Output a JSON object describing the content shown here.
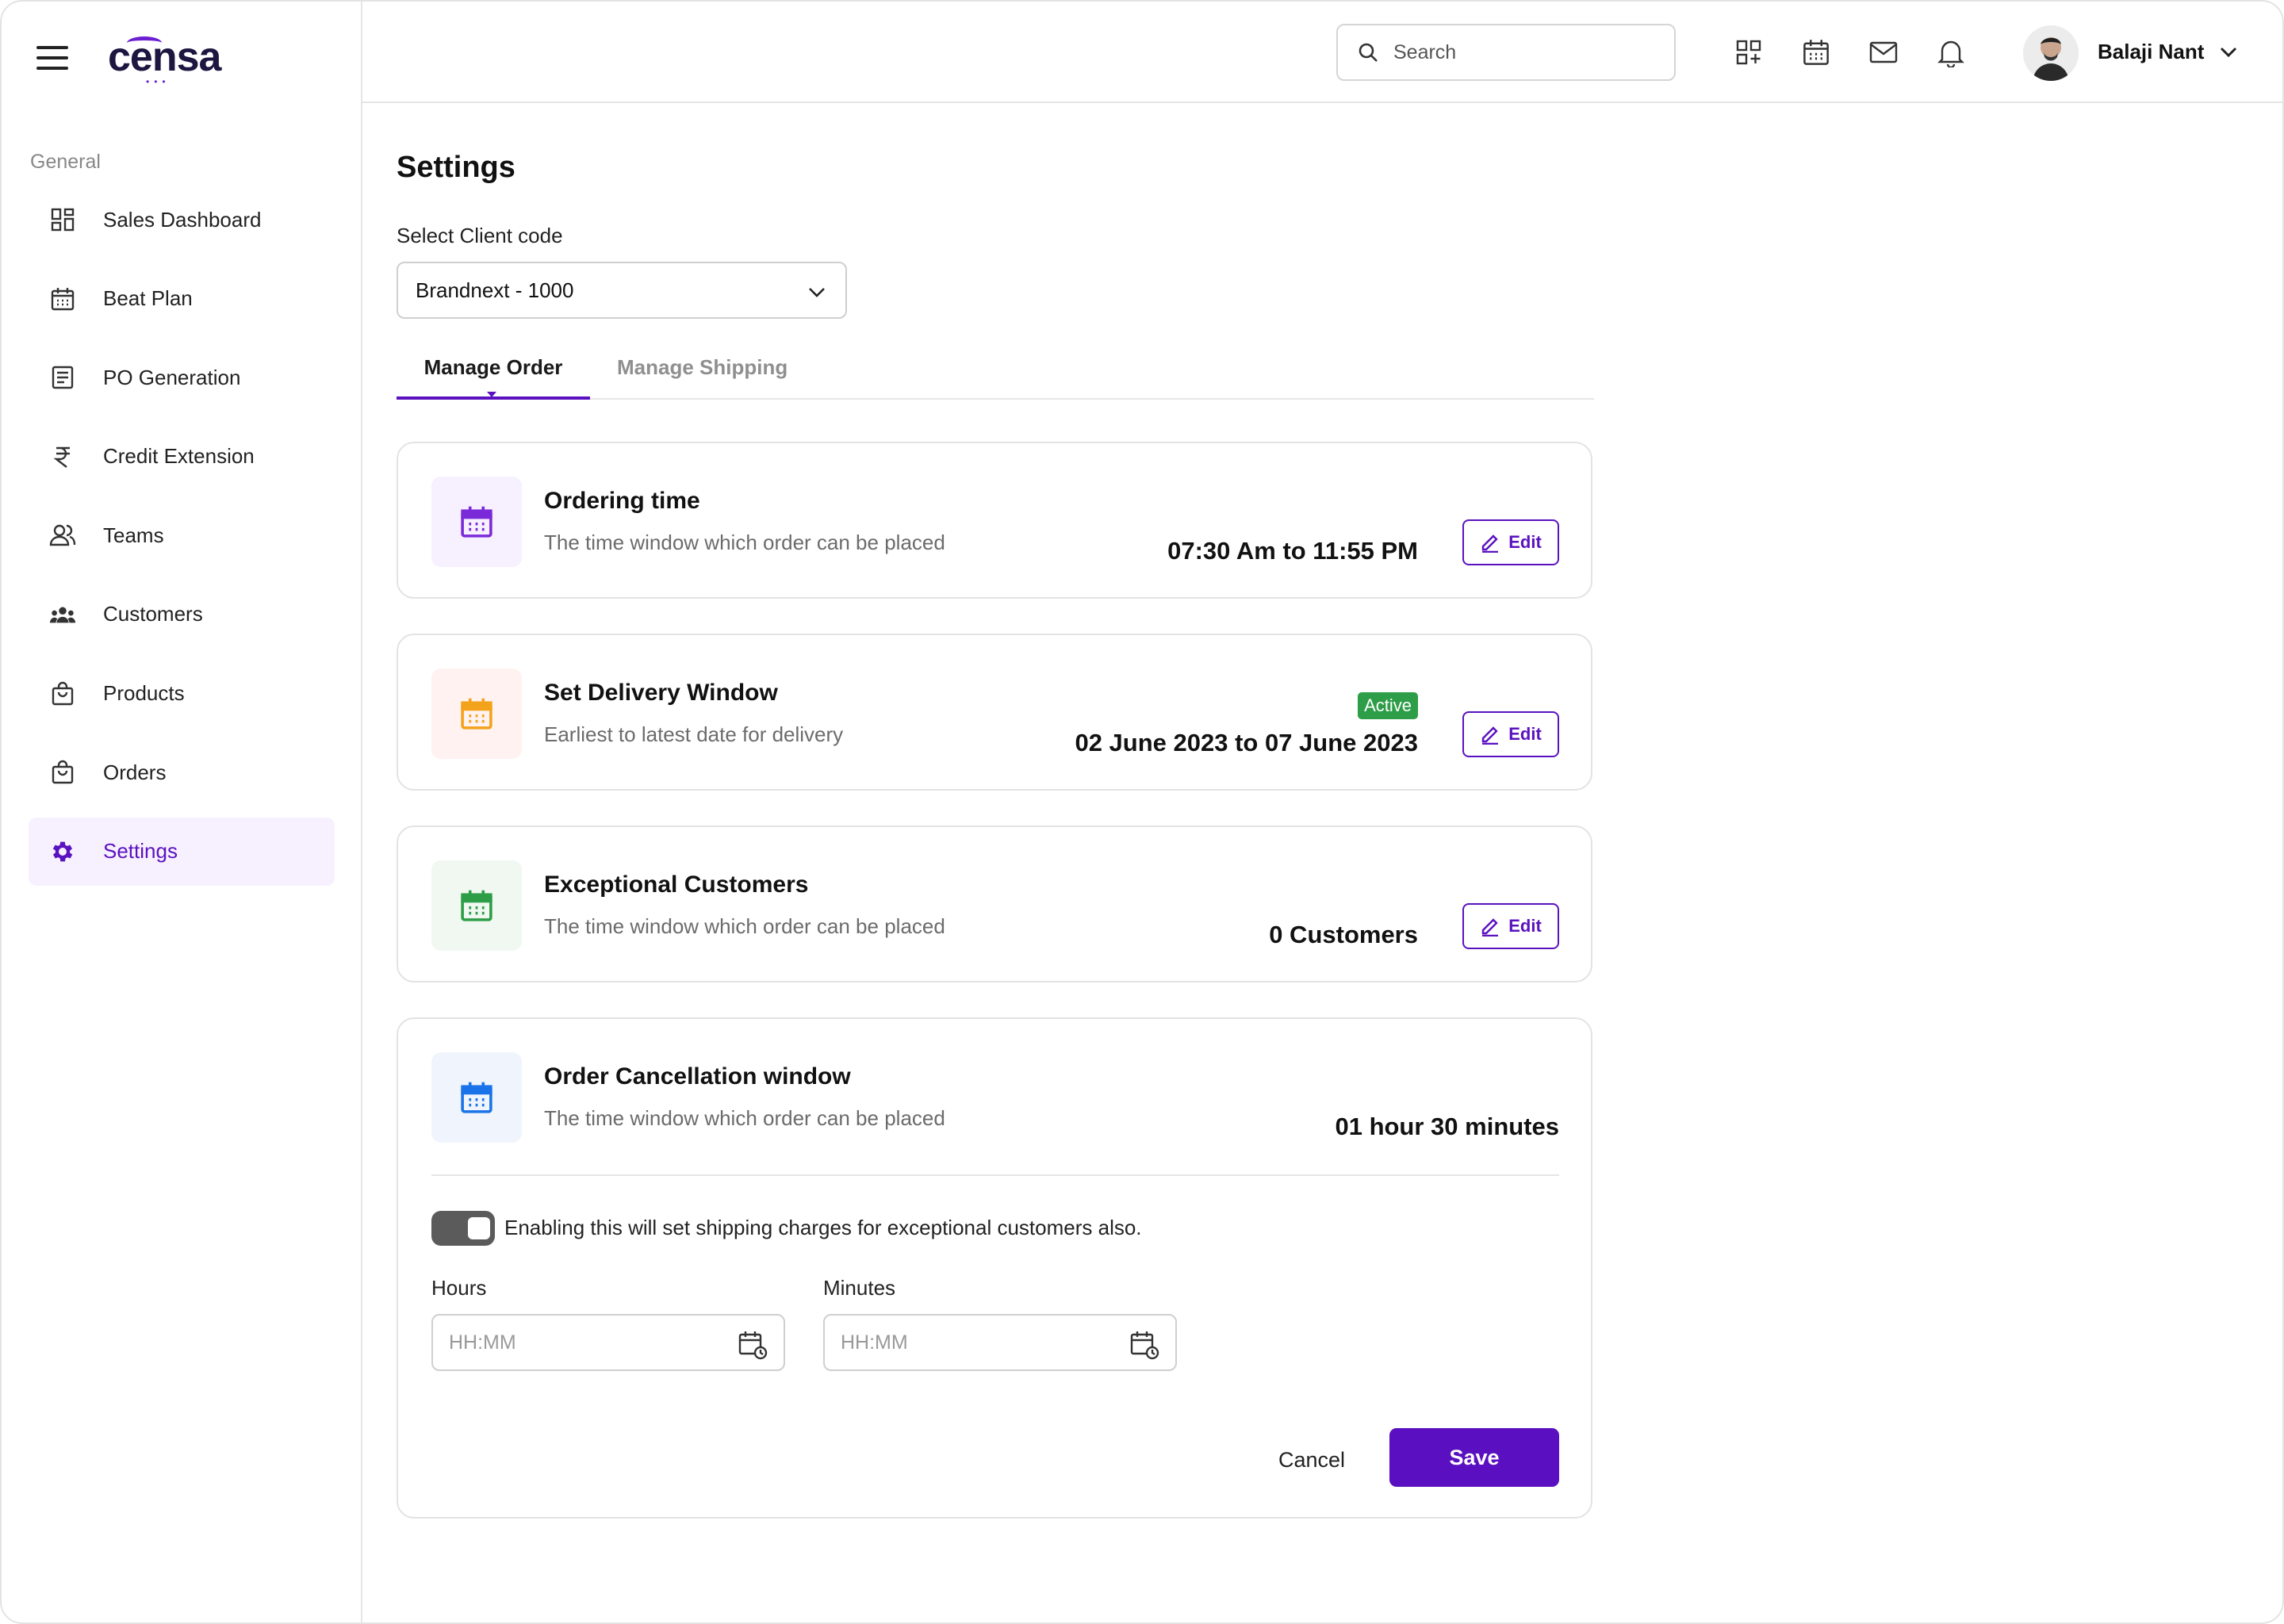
{
  "app": {
    "logo_text": "censa"
  },
  "sidebar": {
    "section_label": "General",
    "items": [
      {
        "label": "Sales Dashboard",
        "icon": "dashboard-grid-icon"
      },
      {
        "label": "Beat Plan",
        "icon": "calendar-icon"
      },
      {
        "label": "PO Generation",
        "icon": "document-icon"
      },
      {
        "label": "Credit Extension",
        "icon": "rupee-icon"
      },
      {
        "label": "Teams",
        "icon": "users-icon"
      },
      {
        "label": "Customers",
        "icon": "customers-group-icon"
      },
      {
        "label": "Products",
        "icon": "shopping-bag-icon"
      },
      {
        "label": "Orders",
        "icon": "shopping-bag-icon"
      },
      {
        "label": "Settings",
        "icon": "gear-icon",
        "active": true
      }
    ]
  },
  "topbar": {
    "search_placeholder": "Search",
    "user_name": "Balaji Nant"
  },
  "page": {
    "title": "Settings",
    "client_label": "Select Client code",
    "client_value": "Brandnext - 1000",
    "tabs": [
      {
        "label": "Manage Order",
        "active": true
      },
      {
        "label": "Manage Shipping",
        "active": false
      }
    ]
  },
  "cards": [
    {
      "title": "Ordering time",
      "subtitle": "The time window which order can be placed",
      "value": "07:30 Am to 11:55 PM",
      "edit_label": "Edit",
      "icon_color": "#7b2ad9",
      "icon_bg": "#f6f0ff"
    },
    {
      "title": "Set Delivery Window",
      "subtitle": "Earliest to latest date for delivery",
      "value": "02 June 2023 to 07 June 2023",
      "badge": "Active",
      "edit_label": "Edit",
      "icon_color": "#f3a21b",
      "icon_bg": "#fff2f0"
    },
    {
      "title": "Exceptional Customers",
      "subtitle": "The time window which order can be placed",
      "value": "0 Customers",
      "edit_label": "Edit",
      "icon_color": "#2e9d47",
      "icon_bg": "#f0f8f1"
    },
    {
      "title": "Order Cancellation window",
      "subtitle": "The time window which order can be placed",
      "value": "01 hour 30 minutes",
      "icon_color": "#1a73e8",
      "icon_bg": "#f0f5fd",
      "toggle_text": "Enabling this will set shipping charges for exceptional customers also.",
      "hours_label": "Hours",
      "hours_placeholder": "HH:MM",
      "minutes_label": "Minutes",
      "minutes_placeholder": "HH:MM",
      "cancel_label": "Cancel",
      "save_label": "Save"
    }
  ],
  "colors": {
    "accent": "#5a12c0",
    "active_bg": "#f7f0ff"
  }
}
